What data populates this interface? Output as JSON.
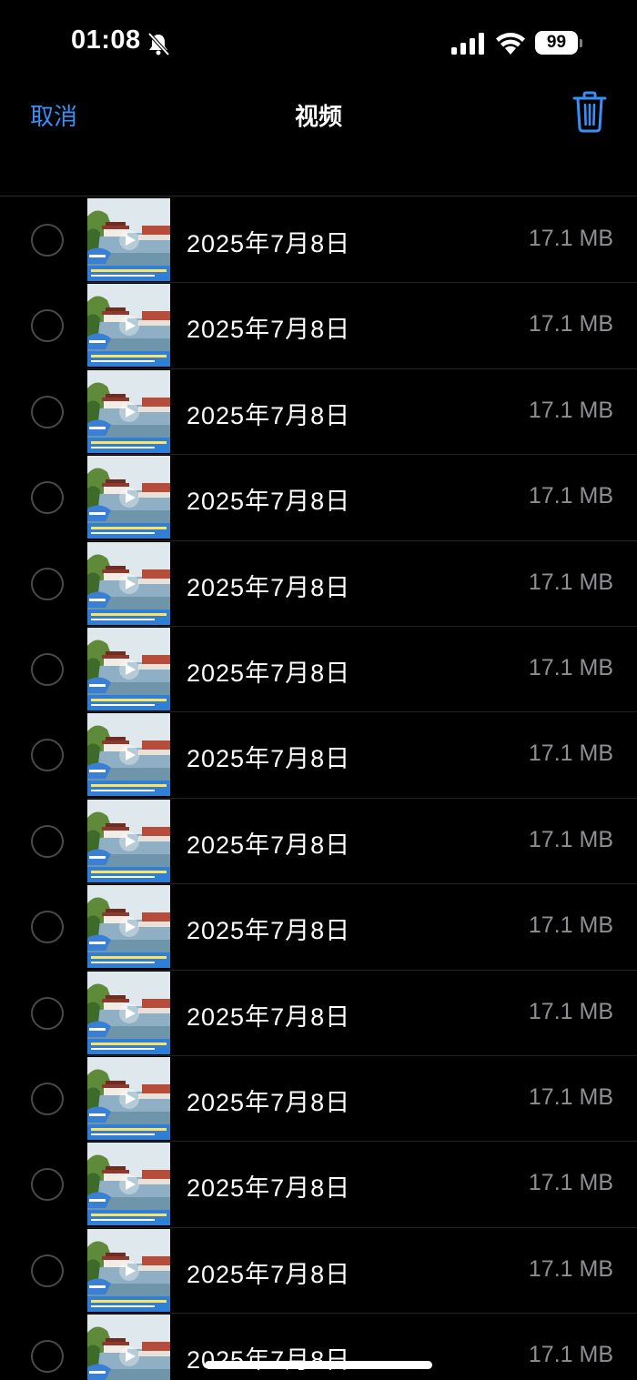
{
  "status_bar": {
    "time": "01:08",
    "battery": "99",
    "icons": [
      "bell-slash-icon",
      "cellular-signal-icon",
      "wifi-icon",
      "battery-icon"
    ]
  },
  "nav": {
    "cancel_label": "取消",
    "title": "视频",
    "trash_icon": "trash-icon",
    "accent_color": "#3a8ff7"
  },
  "videos": [
    {
      "date": "2025年7月8日",
      "size": "17.1 MB",
      "selected": false
    },
    {
      "date": "2025年7月8日",
      "size": "17.1 MB",
      "selected": false
    },
    {
      "date": "2025年7月8日",
      "size": "17.1 MB",
      "selected": false
    },
    {
      "date": "2025年7月8日",
      "size": "17.1 MB",
      "selected": false
    },
    {
      "date": "2025年7月8日",
      "size": "17.1 MB",
      "selected": false
    },
    {
      "date": "2025年7月8日",
      "size": "17.1 MB",
      "selected": false
    },
    {
      "date": "2025年7月8日",
      "size": "17.1 MB",
      "selected": false
    },
    {
      "date": "2025年7月8日",
      "size": "17.1 MB",
      "selected": false
    },
    {
      "date": "2025年7月8日",
      "size": "17.1 MB",
      "selected": false
    },
    {
      "date": "2025年7月8日",
      "size": "17.1 MB",
      "selected": false
    },
    {
      "date": "2025年7月8日",
      "size": "17.1 MB",
      "selected": false
    },
    {
      "date": "2025年7月8日",
      "size": "17.1 MB",
      "selected": false
    },
    {
      "date": "2025年7月8日",
      "size": "17.1 MB",
      "selected": false
    },
    {
      "date": "2025年7月8日",
      "size": "17.1 MB",
      "selected": false
    }
  ]
}
